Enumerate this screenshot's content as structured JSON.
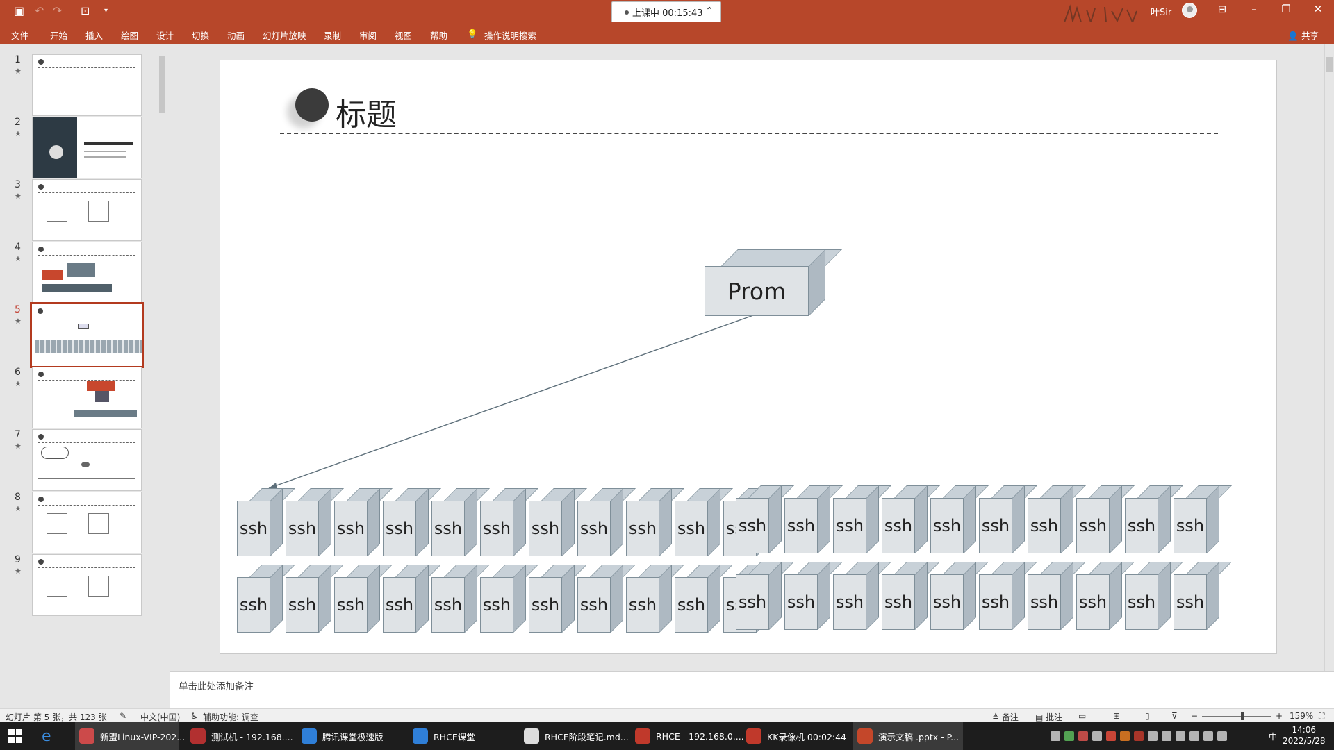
{
  "titlebar": {
    "timer_status": "上课中 00:15:43",
    "user": "叶Sir",
    "window_buttons": [
      "ribbon-display-icon",
      "minimize-icon",
      "restore-icon",
      "close-icon"
    ]
  },
  "ribbon": {
    "tabs": [
      "文件",
      "开始",
      "插入",
      "绘图",
      "设计",
      "切换",
      "动画",
      "幻灯片放映",
      "录制",
      "审阅",
      "视图",
      "帮助"
    ],
    "search_label": "操作说明搜索",
    "share": "共享"
  },
  "thumbnails": [
    {
      "num": "1",
      "selected": false
    },
    {
      "num": "2",
      "selected": false
    },
    {
      "num": "3",
      "selected": false
    },
    {
      "num": "4",
      "selected": false
    },
    {
      "num": "5",
      "selected": true
    },
    {
      "num": "6",
      "selected": false
    },
    {
      "num": "7",
      "selected": false
    },
    {
      "num": "8",
      "selected": false
    },
    {
      "num": "9",
      "selected": false
    }
  ],
  "slide": {
    "title": "标题",
    "prom_label": "Prom",
    "node_label": "ssh",
    "node_rows": 2,
    "node_groups": [
      11,
      10
    ]
  },
  "notes": {
    "placeholder": "单击此处添加备注"
  },
  "status": {
    "slide_info": "幻灯片 第 5 张，共 123 张",
    "language": "中文(中国)",
    "accessibility": "辅助功能: 调查",
    "notes_btn": "备注",
    "comments_btn": "批注",
    "zoom_minus": "−",
    "zoom_plus": "+",
    "zoom": "159%"
  },
  "taskbar": {
    "items": [
      {
        "label": "新盟Linux-VIP-202...",
        "color": "#cc4a4a",
        "active": true
      },
      {
        "label": "测试机 - 192.168....",
        "color": "#b23030",
        "active": false
      },
      {
        "label": "腾讯课堂极速版",
        "color": "#2f7fd8",
        "active": false
      },
      {
        "label": "RHCE课堂",
        "color": "#2f7fd8",
        "active": false
      },
      {
        "label": "RHCE阶段笔记.md...",
        "color": "#dddddd",
        "active": false
      },
      {
        "label": "RHCE - 192.168.0....",
        "color": "#c0392b",
        "active": false
      },
      {
        "label": "KK录像机 00:02:44",
        "color": "#c0392b",
        "active": false
      },
      {
        "label": "演示文稿 .pptx - P...",
        "color": "#c4472a",
        "active": true
      }
    ],
    "ime": "中",
    "time": "14:06",
    "date": "2022/5/28"
  }
}
